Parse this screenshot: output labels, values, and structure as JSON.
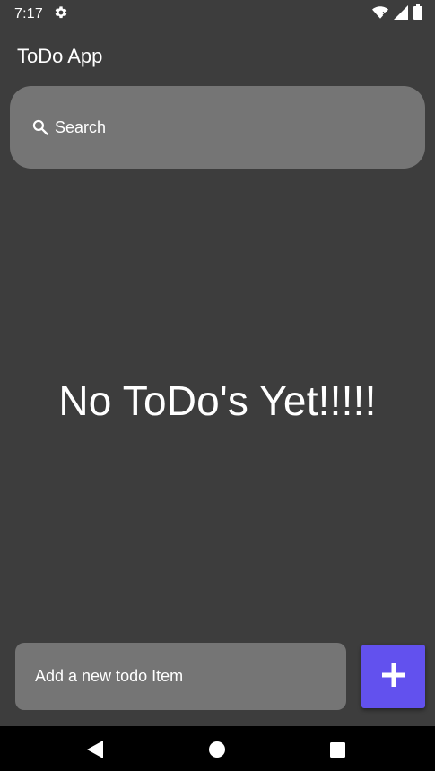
{
  "status_bar": {
    "time": "7:17",
    "settings_icon": "gear-icon",
    "wifi_icon": "wifi-icon",
    "signal_icon": "cellular-signal-icon",
    "battery_icon": "battery-icon"
  },
  "app_bar": {
    "title": "ToDo App"
  },
  "search": {
    "label": "Search",
    "icon": "search-icon"
  },
  "main": {
    "empty_message": "No ToDo's Yet!!!!!"
  },
  "composer": {
    "placeholder": "Add a new todo Item",
    "value": "",
    "add_icon": "plus-icon"
  },
  "nav_bar": {
    "back_icon": "back-triangle-icon",
    "home_icon": "home-circle-icon",
    "recents_icon": "recents-square-icon"
  },
  "colors": {
    "background": "#3d3d3d",
    "field": "#757575",
    "accent": "#6251ee",
    "nav_bar": "#000000"
  }
}
